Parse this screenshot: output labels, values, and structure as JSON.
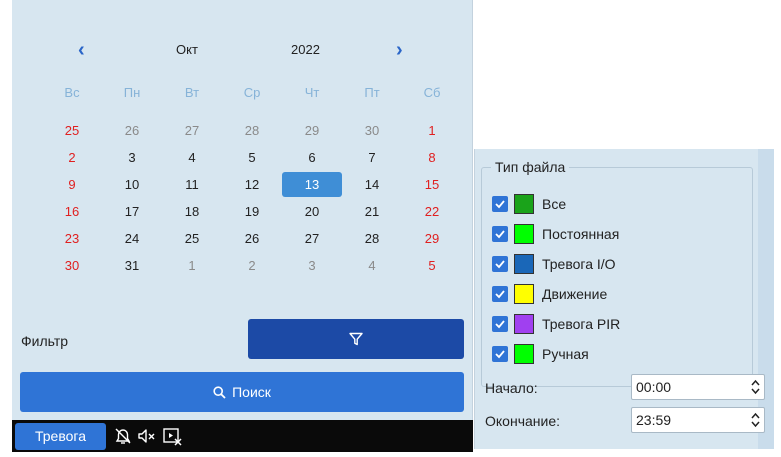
{
  "calendar": {
    "prev_icon": "chevron-left-icon",
    "next_icon": "chevron-right-icon",
    "month": "Окт",
    "year": "2022",
    "weekdays": [
      "Вс",
      "Пн",
      "Вт",
      "Ср",
      "Чт",
      "Пт",
      "Сб"
    ],
    "weeks": [
      [
        "25",
        "26",
        "27",
        "28",
        "29",
        "30",
        "1"
      ],
      [
        "2",
        "3",
        "4",
        "5",
        "6",
        "7",
        "8"
      ],
      [
        "9",
        "10",
        "11",
        "12",
        "13",
        "14",
        "15"
      ],
      [
        "16",
        "17",
        "18",
        "19",
        "20",
        "21",
        "22"
      ],
      [
        "23",
        "24",
        "25",
        "26",
        "27",
        "28",
        "29"
      ],
      [
        "30",
        "31",
        "1",
        "2",
        "3",
        "4",
        "5"
      ]
    ],
    "selected_day": "13"
  },
  "filter": {
    "label": "Фильтр",
    "button_icon": "filter-icon"
  },
  "search": {
    "label": "Поиск",
    "icon": "search-icon"
  },
  "bottom_bar": {
    "alarm_tab": "Тревога",
    "icons": [
      "alarm-bell-icon",
      "mute-icon",
      "close-playback-icon"
    ]
  },
  "file_type": {
    "title": "Тип файла",
    "items": [
      {
        "label": "Все",
        "color": "#1aa31a",
        "checked": true
      },
      {
        "label": "Постоянная",
        "color": "#00ff00",
        "checked": true
      },
      {
        "label": "Тревога I/O",
        "color": "#1a67b8",
        "checked": true
      },
      {
        "label": "Движение",
        "color": "#ffff00",
        "checked": true
      },
      {
        "label": "Тревога PIR",
        "color": "#a040f0",
        "checked": true
      },
      {
        "label": "Ручная",
        "color": "#00ff00",
        "checked": true
      }
    ]
  },
  "time": {
    "start_label": "Начало:",
    "start_value": "00:00",
    "end_label": "Окончание:",
    "end_value": "23:59"
  },
  "colors": {
    "accent": "#2f74d6",
    "filter_button": "#1c4aa6",
    "panel_bg": "#d7e6f0",
    "weekend": "#e02020"
  }
}
